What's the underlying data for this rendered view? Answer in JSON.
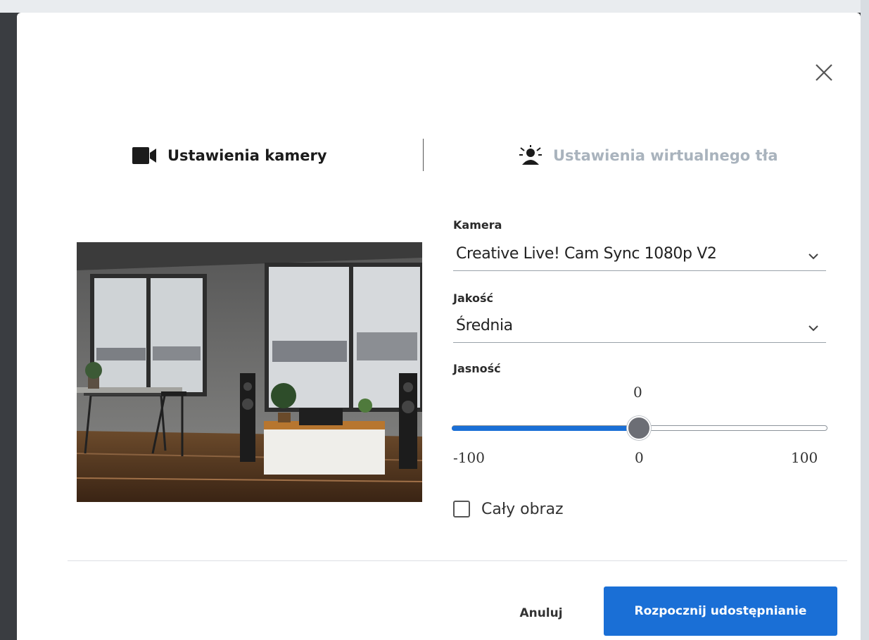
{
  "dialog": {
    "close_icon": "close-icon",
    "tabs": [
      {
        "label": "Ustawienia kamery",
        "icon": "video-camera-icon",
        "active": true
      },
      {
        "label": "Ustawienia wirtualnego tła",
        "icon": "virtual-background-icon",
        "active": false
      }
    ],
    "preview": {
      "icon": "camera-preview-image"
    },
    "camera": {
      "label": "Kamera",
      "value": "Creative Live! Cam Sync 1080p V2",
      "icon": "chevron-down-icon"
    },
    "quality": {
      "label": "Jakość",
      "value": "Średnia",
      "icon": "chevron-down-icon"
    },
    "brightness": {
      "label": "Jasność",
      "value": "0",
      "min_label": "-100",
      "mid_label": "0",
      "max_label": "100",
      "min": -100,
      "max": 100,
      "current": 0
    },
    "full_image": {
      "label": "Cały obraz",
      "checked": false
    },
    "footer": {
      "cancel_label": "Anuluj",
      "primary_label": "Rozpocznij udostępnianie"
    }
  },
  "colors": {
    "accent": "#1a6fd6",
    "thumb": "#6c6e75",
    "inactive_tab": "#a9b3bd"
  }
}
